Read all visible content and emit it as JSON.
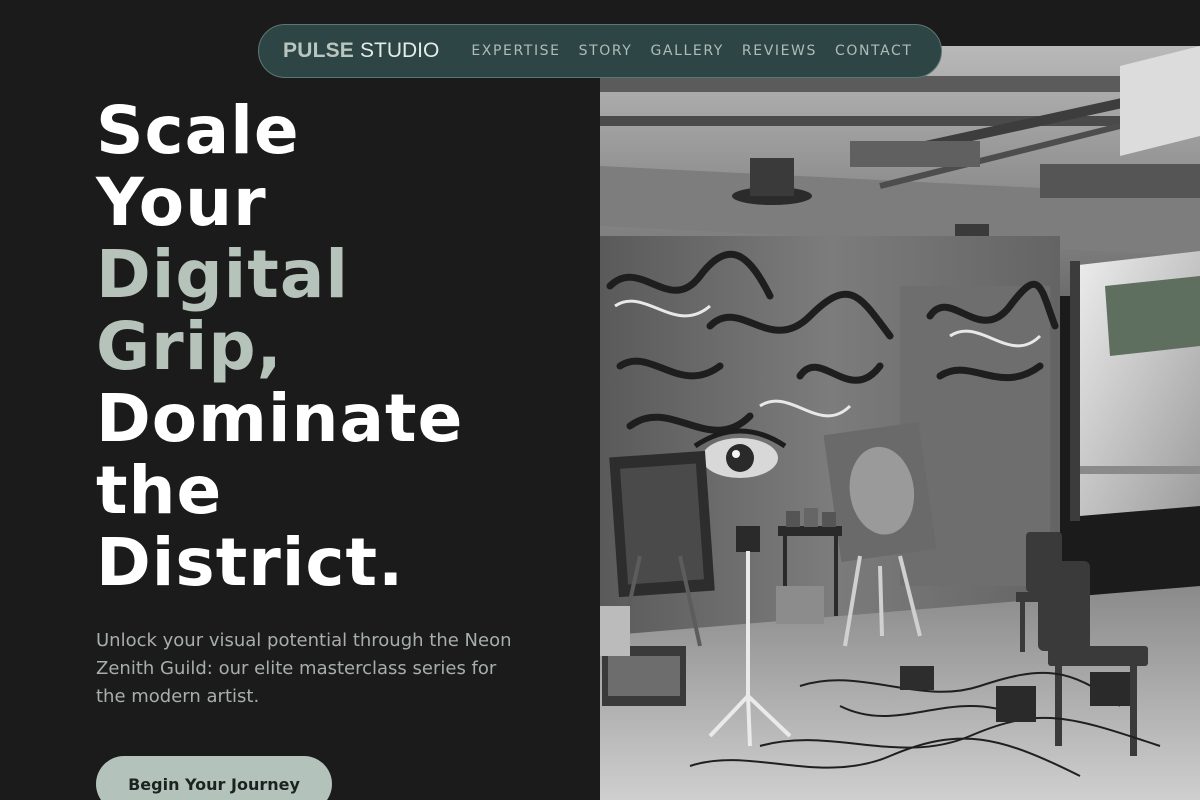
{
  "nav": {
    "logo_bold": "PULSE",
    "logo_light": "STUDIO",
    "links": [
      "EXPERTISE",
      "STORY",
      "GALLERY",
      "REVIEWS",
      "CONTACT"
    ]
  },
  "hero": {
    "headline_lines": [
      "Scale",
      "Your",
      "Digital",
      "Grip,",
      "Dominate",
      "the",
      "District."
    ],
    "subtitle": "Unlock your visual potential through the Neon Zenith Guild: our elite masterclass series for the modern artist.",
    "cta_label": "Begin Your Journey"
  },
  "colors": {
    "background": "#1b1b1b",
    "nav_background": "#2e4545",
    "accent": "#b5c3bb",
    "headline": "#ffffff",
    "muted_text": "#a7aeab"
  },
  "icons": [
    "studio-photo"
  ]
}
